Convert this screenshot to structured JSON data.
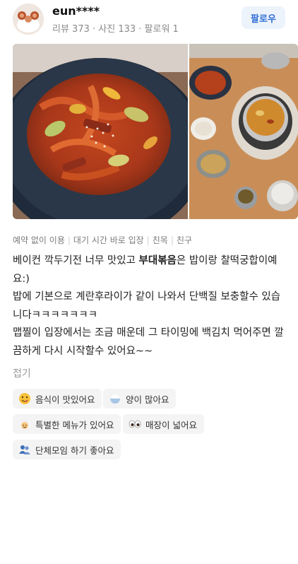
{
  "profile": {
    "username": "eun****",
    "stats": "리뷰 373 · 사진 133 · 팔로워 1",
    "follow_label": "팔로우"
  },
  "tags": [
    "예약 없이 이용",
    "대기 시간 바로 입장",
    "친목",
    "친구"
  ],
  "review": {
    "line1_pre": "베이컨 깍두기전 너무 맛있고 ",
    "line1_bold": "부대볶음",
    "line1_post": "은 밥이랑 찰떡궁합이예요:)",
    "line2": "밥에 기본으로 계란후라이가 같이 나와서 단백질 보충할수 있습니다ㅋㅋㅋㅋㅋㅋㅋ",
    "line3": "맵찔이 입장에서는 조금 매운데 그 타이밍에 백김치 먹어주면 깔끔하게 다시 시작할수 있어요~~",
    "fold_label": "접기"
  },
  "keywords": [
    {
      "icon": "yum-face-icon",
      "label": "음식이 맛있어요"
    },
    {
      "icon": "rice-bowl-icon",
      "label": "양이 많아요"
    },
    {
      "icon": "chef-icon",
      "label": "특별한 메뉴가 있어요"
    },
    {
      "icon": "eyes-icon",
      "label": "매장이 넓어요"
    },
    {
      "icon": "group-icon",
      "label": "단체모임 하기 좋아요"
    }
  ]
}
